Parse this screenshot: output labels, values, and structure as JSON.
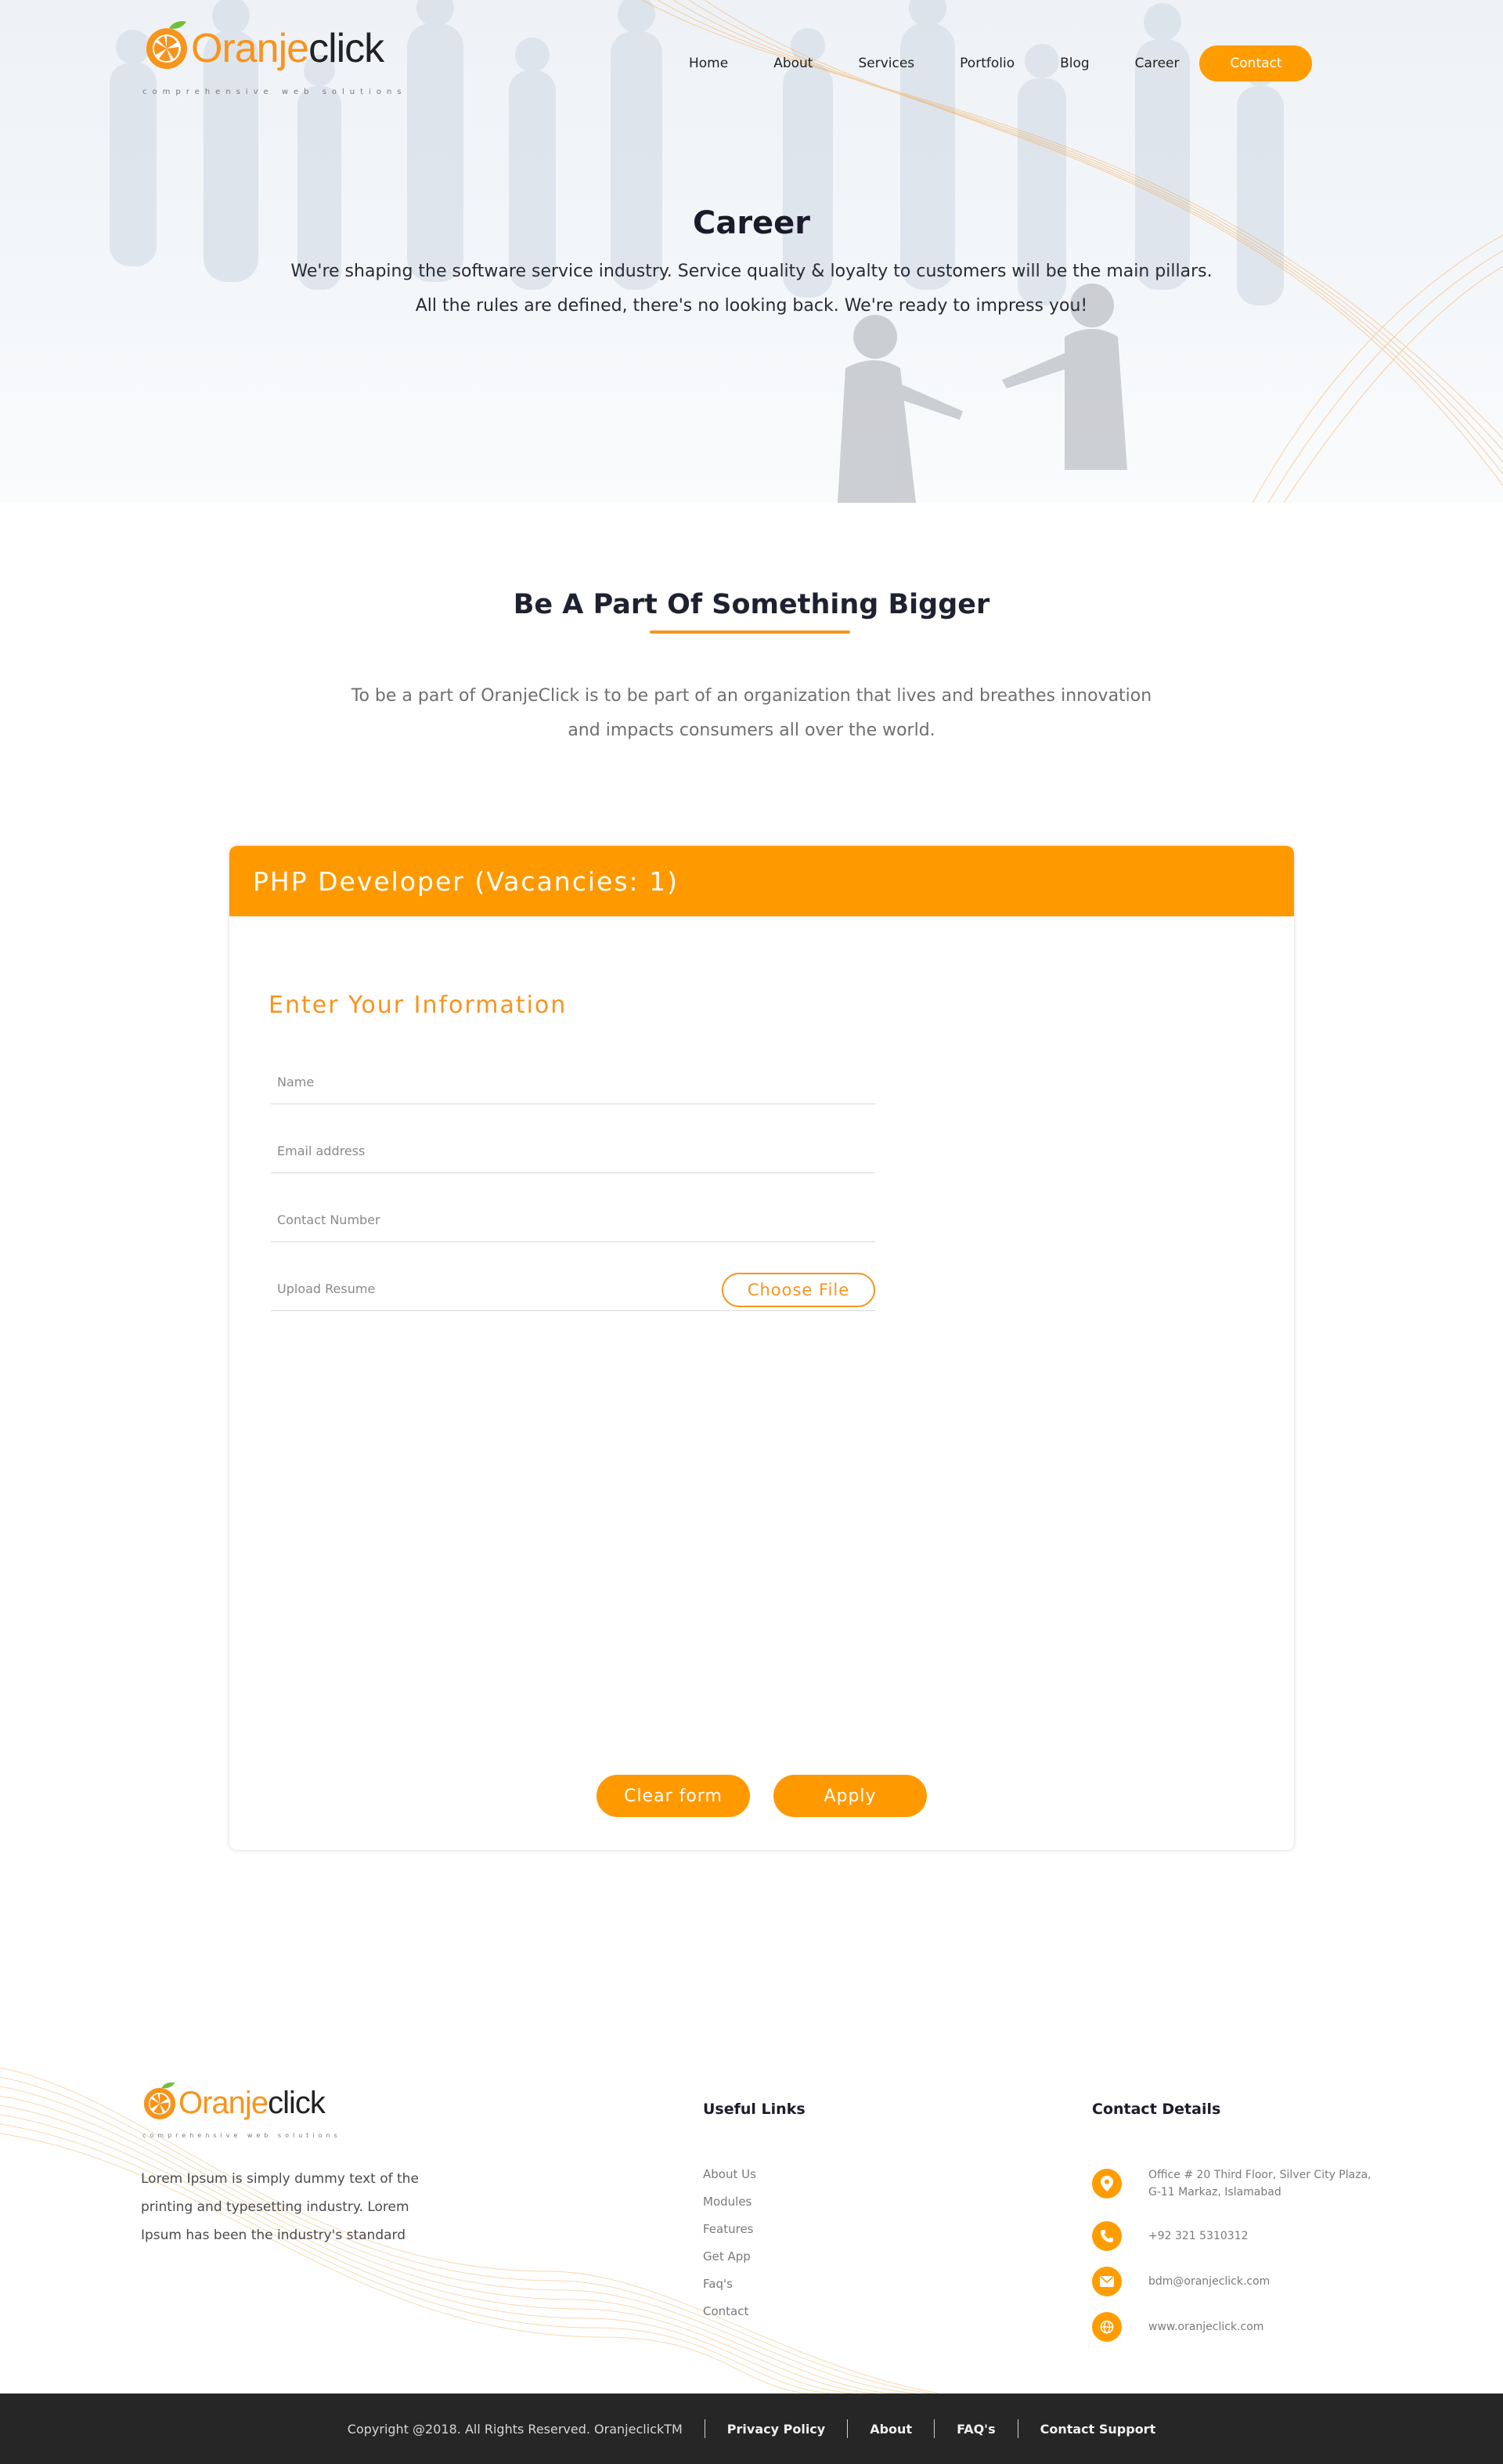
{
  "colors": {
    "brand_orange": "#ff9900",
    "accent_orange": "#f7941d",
    "dark_text": "#1b1b2b",
    "footer_bar": "#262626"
  },
  "brand": {
    "logo_first": "Oranje",
    "logo_second": "click",
    "tagline": "comprehensive web solutions"
  },
  "nav": {
    "items": [
      "Home",
      "About",
      "Services",
      "Portfolio",
      "Blog",
      "Career"
    ],
    "contact": "Contact"
  },
  "hero": {
    "title": "Career",
    "line1": "We're shaping the software service industry. Service quality & loyalty to customers will be the main pillars.",
    "line2": "All the rules are defined, there's no looking back. We're ready to impress you!"
  },
  "intro": {
    "title": "Be A Part Of Something Bigger",
    "line1": "To be a part of OranjeClick is to be part of an organization that lives and breathes innovation",
    "line2": "and impacts consumers all over the world."
  },
  "job": {
    "title": "PHP Developer (Vacancies: 1)",
    "form_title": "Enter Your Information",
    "fields": {
      "name": {
        "placeholder": "Name",
        "value": ""
      },
      "email": {
        "placeholder": "Email address",
        "value": ""
      },
      "contact": {
        "placeholder": "Contact Number",
        "value": ""
      },
      "resume": {
        "label": "Upload Resume",
        "button": "Choose File"
      }
    },
    "clear_label": "Clear form",
    "apply_label": "Apply"
  },
  "footer": {
    "about": "Lorem Ipsum is simply dummy text of the printing and typesetting industry. Lorem Ipsum has been the industry's standard",
    "links_title": "Useful Links",
    "links": [
      "About Us",
      "Modules",
      "Features",
      "Get App",
      "Faq's",
      "Contact"
    ],
    "contact_title": "Contact Details",
    "address_line1": "Office # 20 Third Floor, Silver City Plaza,",
    "address_line2": "G-11 Markaz, Islamabad",
    "phone": "+92 321 5310312",
    "email": "bdm@oranjeclick.com",
    "website": "www.oranjeclick.com",
    "icons": [
      "location-icon",
      "phone-icon",
      "mail-icon",
      "globe-icon"
    ]
  },
  "bottom_bar": {
    "copyright": "Copyright @2018. All Rights Reserved. OranjeclickTM",
    "links": [
      "Privacy Policy",
      "About",
      "FAQ's",
      "Contact Support"
    ]
  }
}
